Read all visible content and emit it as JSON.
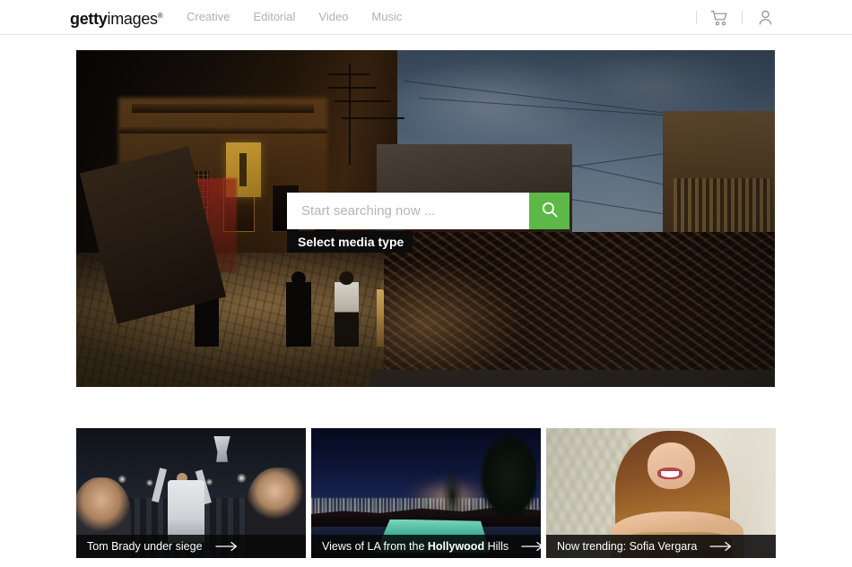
{
  "header": {
    "logo": {
      "bold": "getty",
      "regular": "images",
      "tm": "®"
    },
    "nav": [
      {
        "label": "Creative",
        "name": "nav-creative"
      },
      {
        "label": "Editorial",
        "name": "nav-editorial"
      },
      {
        "label": "Video",
        "name": "nav-video"
      },
      {
        "label": "Music",
        "name": "nav-music"
      }
    ],
    "actions": [
      {
        "icon": "cart-icon",
        "label": "Cart"
      },
      {
        "icon": "user-icon",
        "label": "Account"
      }
    ]
  },
  "hero": {
    "alt": "Night street scene with damaged buildings and a pile of brick rubble; four people walking",
    "search": {
      "placeholder": "Start searching now ...",
      "value": "",
      "button_icon": "search-icon",
      "button_color": "#5cb947",
      "media_type_label": "Select media type"
    }
  },
  "cards": [
    {
      "name": "card-tom-brady",
      "caption_prefix": "Tom Brady under siege",
      "caption_bold": "",
      "caption_suffix": "",
      "arrow": "→",
      "alt": "Tom Brady raising trophy in stadium"
    },
    {
      "name": "card-hollywood-hills",
      "caption_prefix": "Views of LA from the ",
      "caption_bold": "Hollywood",
      "caption_suffix": " Hills",
      "arrow": "→",
      "alt": "Night view of Los Angeles city lights with lit swimming pool"
    },
    {
      "name": "card-sofia-vergara",
      "caption_prefix": "Now trending: Sofia Vergara",
      "caption_bold": "",
      "caption_suffix": "",
      "arrow": "→",
      "alt": "Sofia Vergara smiling"
    }
  ]
}
